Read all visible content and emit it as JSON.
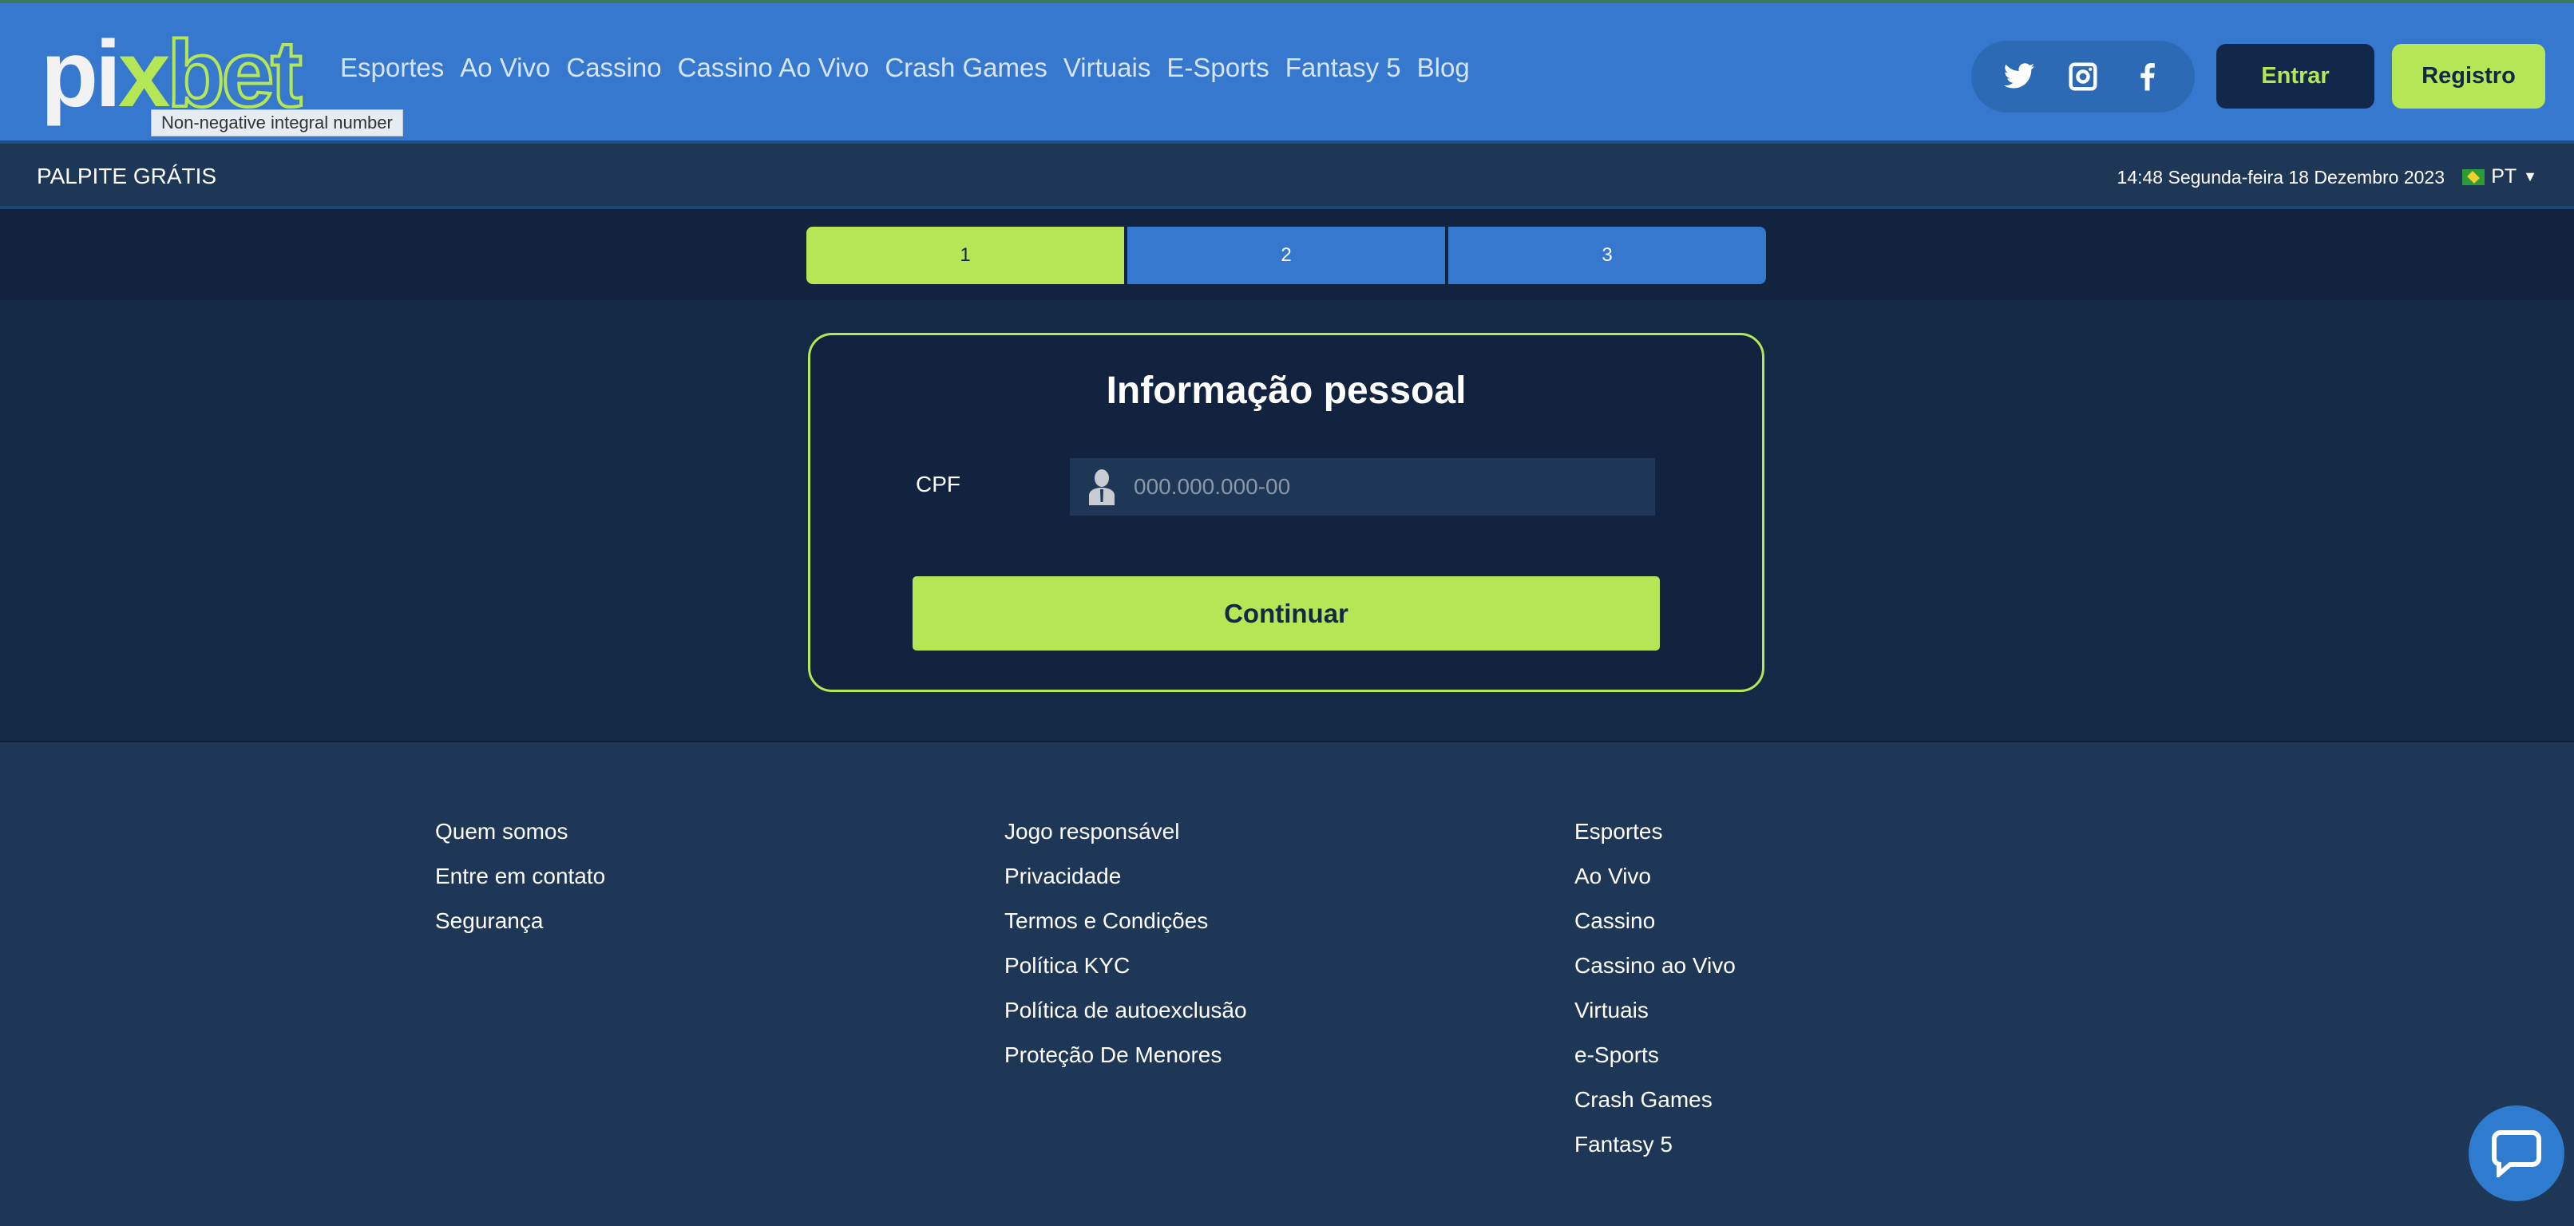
{
  "header": {
    "logo": "pixbet",
    "nav": [
      "Esportes",
      "Ao Vivo",
      "Cassino",
      "Cassino Ao Vivo",
      "Crash Games",
      "Virtuais",
      "E-Sports",
      "Fantasy 5",
      "Blog"
    ],
    "tooltip": "Non-negative integral number",
    "login": "Entrar",
    "register": "Registro",
    "social": [
      "twitter-icon",
      "instagram-icon",
      "facebook-icon"
    ]
  },
  "subbar": {
    "promo": "PALPITE GRÁTIS",
    "datetime": "14:48 Segunda-feira 18 Dezembro 2023",
    "language": "PT"
  },
  "steps": [
    {
      "label": "1",
      "active": true
    },
    {
      "label": "2",
      "active": false
    },
    {
      "label": "3",
      "active": false
    }
  ],
  "form": {
    "title": "Informação pessoal",
    "cpf_label": "CPF",
    "cpf_placeholder": "000.000.000-00",
    "cpf_value": "",
    "submit": "Continuar"
  },
  "footer": {
    "col1": [
      "Quem somos",
      "Entre em contato",
      "Segurança"
    ],
    "col2": [
      "Jogo responsável",
      "Privacidade",
      "Termos e Condições",
      "Política KYC",
      "Política de autoexclusão",
      "Proteção De Menores"
    ],
    "col3": [
      "Esportes",
      "Ao Vivo",
      "Cassino",
      "Cassino ao Vivo",
      "Virtuais",
      "e-Sports",
      "Crash Games",
      "Fantasy 5"
    ]
  },
  "colors": {
    "header": "#3578cd",
    "accent": "#b5e655",
    "dark": "#12284a"
  }
}
